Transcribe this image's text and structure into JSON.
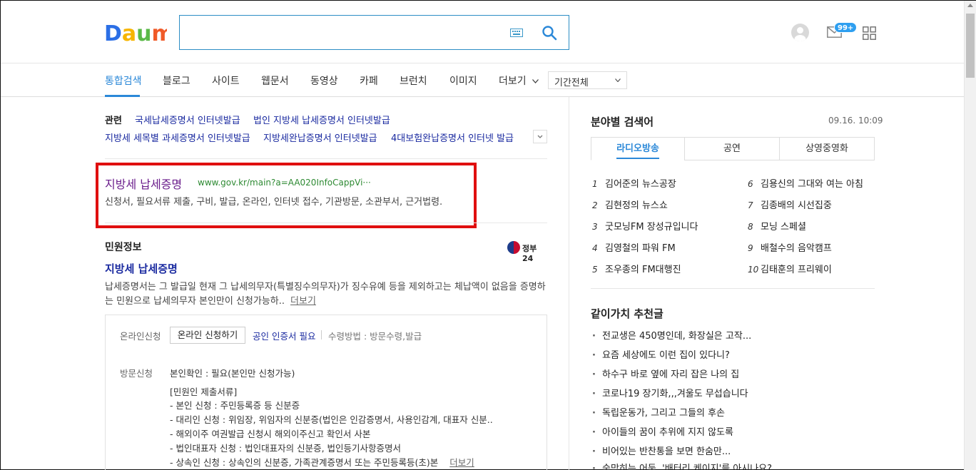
{
  "header": {
    "logo_text": "Daum",
    "search_placeholder": "",
    "mail_badge": "99+"
  },
  "tabs": [
    {
      "label": "통합검색",
      "active": true
    },
    {
      "label": "블로그"
    },
    {
      "label": "사이트"
    },
    {
      "label": "웹문서"
    },
    {
      "label": "동영상"
    },
    {
      "label": "카페"
    },
    {
      "label": "브런치"
    },
    {
      "label": "이미지"
    },
    {
      "label": "더보기"
    }
  ],
  "period_select": "기간전체",
  "related": {
    "label": "관련",
    "links": [
      "국세납세증명서 인터넷발급",
      "법인 지방세 납세증명서 인터넷발급",
      "지방세 세목별 과세증명서 인터넷발급",
      "지방세완납증명서 인터넷발급",
      "4대보험완납증명서 인터넷 발급"
    ]
  },
  "result1": {
    "title": "지방세 납세증명",
    "url": "www.gov.kr/main?a=AA020InfoCappVi···",
    "desc": "신청서, 필요서류 제출, 구비, 발급, 온라인, 인터넷 접수, 기관방문, 소관부서, 근거법령."
  },
  "civil": {
    "section_title": "민원정보",
    "gov_label": "정부24",
    "title": "지방세 납세증명",
    "desc": "납세증명서는 그 발급일 현재 그 납세의무자(특별징수의무자)가 징수유예 등을 제외하고는 체납액이 없음을 증명하는 민원으로 납세의무자 본인만이 신청가능하..",
    "more": "더보기",
    "online_label": "온라인신청",
    "online_button": "온라인 신청하기",
    "cert_link": "공인 인증서 필요",
    "receive": "수령방법 : 방문수령,발급",
    "visit_label": "방문신청",
    "visit_lines": [
      "본인확인 : 필요(본인만 신청가능)",
      "[민원인 제출서류]",
      "- 본인 신청 : 주민등록증 등 신분증",
      "- 대리인 신청 : 위임장, 위임자의 신분증(법인은 인감증명서, 사용인감계, 대표자 신분..",
      "- 해외이주 여권발급 신청시 해외이주신고 확인서 사본",
      "- 법인대표자 신청 : 법인대표자의 신분증, 법인등기사항증명서",
      "- 상속인 신청 : 상속인의 신분증, 가족관계증명서 또는 주민등록등(초)본"
    ],
    "visit_more": "더보기"
  },
  "right": {
    "title": "분야별 검색어",
    "time": "09.16. 10:09",
    "tabs": [
      "라디오방송",
      "공연",
      "상영중영화"
    ],
    "ranks_left": [
      {
        "n": "1",
        "t": "김어준의 뉴스공장"
      },
      {
        "n": "2",
        "t": "김현정의 뉴스쇼"
      },
      {
        "n": "3",
        "t": "굿모닝FM 장성규입니다"
      },
      {
        "n": "4",
        "t": "김영철의 파워 FM"
      },
      {
        "n": "5",
        "t": "조우종의 FM대행진"
      }
    ],
    "ranks_right": [
      {
        "n": "6",
        "t": "김용신의 그대와 여는 아침"
      },
      {
        "n": "7",
        "t": "김종배의 시선집중"
      },
      {
        "n": "8",
        "t": "모닝 스페셜"
      },
      {
        "n": "9",
        "t": "배철수의 음악캠프"
      },
      {
        "n": "10",
        "t": "김태훈의 프리웨이"
      }
    ],
    "rec_title": "같이가치 추천글",
    "recs": [
      "전교생은 450명인데, 화장실은 고작...",
      "요즘 세상에도 이런 집이 있다니?",
      "하수구 바로 옆에 자리 잡은 나의 집",
      "코로나19 장기화,,,겨울도 무섭습니다",
      "독립운동가, 그리고 그들의 후손",
      "아이들의 꿈이 추위에 지지 않도록",
      "비어있는 반찬통을 보면 한숨만...",
      "숨막히는 어둠, '배터리 케이지'를 아시나요?"
    ]
  },
  "colors": {
    "accent": "#2b88d8",
    "highlight": "#e00f0f",
    "link": "#1a2aa0",
    "visited": "#6b1e8c",
    "url": "#2e8a33"
  }
}
